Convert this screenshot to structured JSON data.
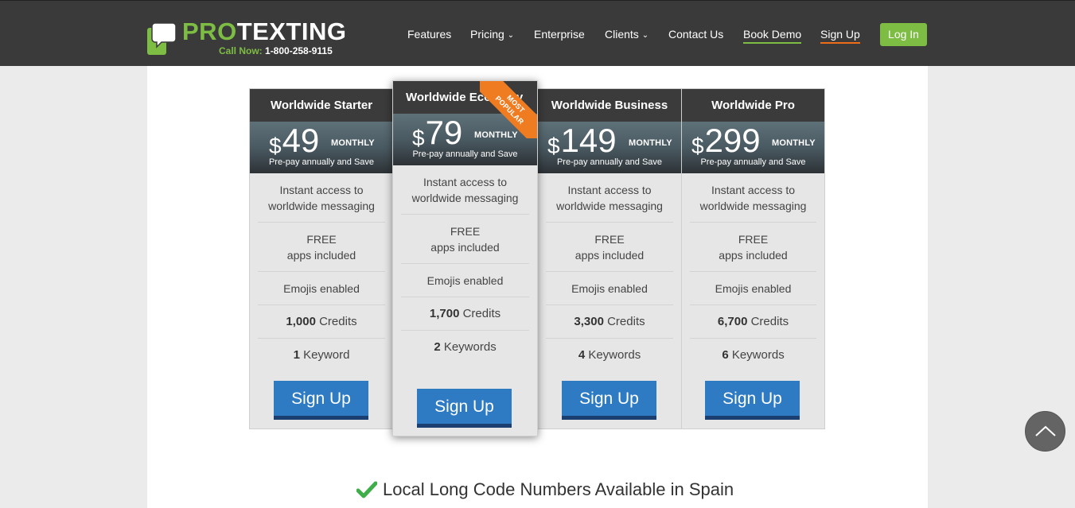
{
  "header": {
    "logo_pro": "PRO",
    "logo_texting": "TEXTING",
    "call_label": "Call Now:",
    "phone": "1-800-258-9115",
    "nav": [
      {
        "label": "Features"
      },
      {
        "label": "Pricing"
      },
      {
        "label": "Enterprise"
      },
      {
        "label": "Clients"
      },
      {
        "label": "Contact Us"
      },
      {
        "label": "Book Demo"
      },
      {
        "label": "Sign Up"
      }
    ],
    "login": "Log In",
    "colors": {
      "brand_green": "#7dbd43",
      "accent_orange": "#ef6c1a",
      "header_bg": "#3a3a3a"
    }
  },
  "plans": [
    {
      "title": "Worldwide Starter",
      "currency": "$",
      "price": "49",
      "period": "MONTHLY",
      "note": "Pre-pay annually and Save",
      "feature1": "Instant access to worldwide messaging",
      "feature2a": "FREE",
      "feature2b": "apps included",
      "feature3": "Emojis enabled",
      "credits_num": "1,000",
      "credits_label": "Credits",
      "keywords_num": "1",
      "keywords_label": "Keyword",
      "button": "Sign Up"
    },
    {
      "title": "Worldwide Economy",
      "currency": "$",
      "price": "79",
      "period": "MONTHLY",
      "note": "Pre-pay annually and Save",
      "feature1": "Instant access to worldwide messaging",
      "feature2a": "FREE",
      "feature2b": "apps included",
      "feature3": "Emojis enabled",
      "credits_num": "1,700",
      "credits_label": "Credits",
      "keywords_num": "2",
      "keywords_label": "Keywords",
      "button": "Sign Up",
      "ribbon_line1": "MOST",
      "ribbon_line2": "POPULAR"
    },
    {
      "title": "Worldwide Business",
      "currency": "$",
      "price": "149",
      "period": "MONTHLY",
      "note": "Pre-pay annually and Save",
      "feature1": "Instant access to worldwide messaging",
      "feature2a": "FREE",
      "feature2b": "apps included",
      "feature3": "Emojis enabled",
      "credits_num": "3,300",
      "credits_label": "Credits",
      "keywords_num": "4",
      "keywords_label": "Keywords",
      "button": "Sign Up"
    },
    {
      "title": "Worldwide Pro",
      "currency": "$",
      "price": "299",
      "period": "MONTHLY",
      "note": "Pre-pay annually and Save",
      "feature1": "Instant access to worldwide messaging",
      "feature2a": "FREE",
      "feature2b": "apps included",
      "feature3": "Emojis enabled",
      "credits_num": "6,700",
      "credits_label": "Credits",
      "keywords_num": "6",
      "keywords_label": "Keywords",
      "button": "Sign Up"
    }
  ],
  "footer": {
    "text": "Local Long Code Numbers Available in Spain",
    "icon": "checkmark-icon"
  },
  "scroll_top_icon": "chevron-up-icon"
}
